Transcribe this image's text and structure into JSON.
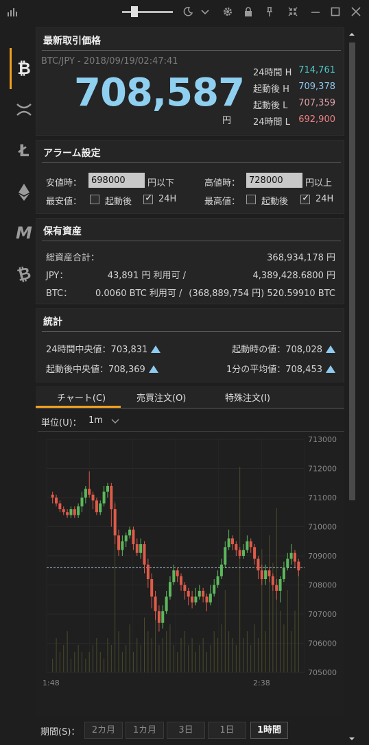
{
  "titlebar": {
    "icons": [
      "chart-bars-icon",
      "moon-icon",
      "chevron-down-icon",
      "gear-icon",
      "lock-icon",
      "pin-icon",
      "collapse-icon",
      "minimize-icon",
      "maximize-icon",
      "close-icon"
    ]
  },
  "sidebar": {
    "items": [
      {
        "name": "bitcoin",
        "glyph": "₿",
        "active": true
      },
      {
        "name": "ripple",
        "glyph": "✕"
      },
      {
        "name": "litecoin",
        "glyph": "Ł"
      },
      {
        "name": "ethereum",
        "glyph": "◆"
      },
      {
        "name": "monacoin",
        "glyph": "M"
      },
      {
        "name": "bitcoin-cash",
        "glyph": "₿"
      }
    ]
  },
  "latest": {
    "title": "最新取引価格",
    "pair_time": "BTC/JPY - 2018/09/19/02:47:41",
    "price": "708,587",
    "unit": "円",
    "stats": [
      {
        "label": "24時間 H",
        "value": "714,761",
        "color": "#4fc8c8"
      },
      {
        "label": "起動後 H",
        "value": "709,378",
        "color": "#8ec9f0"
      },
      {
        "label": "起動後 L",
        "value": "707,359",
        "color": "#e0a0a8"
      },
      {
        "label": "24時間 L",
        "value": "692,900",
        "color": "#f08080"
      }
    ],
    "price_color": "#8fd0f0"
  },
  "alarm": {
    "title": "アラーム設定",
    "low_label": "安値時：",
    "low_value": "698000",
    "low_suffix": "円以下",
    "high_label": "高値時：",
    "high_value": "728000",
    "high_suffix": "円以上",
    "min_label": "最安値：",
    "max_label": "最高値：",
    "since_start": "起動後",
    "h24": "24H",
    "min_since_start_checked": false,
    "min_h24_checked": true,
    "max_since_start_checked": false,
    "max_h24_checked": true
  },
  "assets": {
    "title": "保有資産",
    "total_label": "総資産合計：",
    "total_value": "368,934,178 円",
    "jpy_label": "JPY：",
    "jpy_value": "43,891 円 利用可 /",
    "jpy_total": "4,389,428.6800 円",
    "btc_label": "BTC：",
    "btc_value": "0.0060 BTC 利用可 /",
    "btc_total": "(368,889,754 円) 520.59910 BTC"
  },
  "stats": {
    "title": "統計",
    "median24_label": "24時間中央値：",
    "median24_value": "703,831",
    "start_value_label": "起動時の値：",
    "start_value": "708,028",
    "median_since_label": "起動後中央値：",
    "median_since_value": "708,369",
    "avg1m_label": "1分の平均値：",
    "avg1m_value": "708,453"
  },
  "tabs": [
    {
      "label": "チャート(C)",
      "active": true
    },
    {
      "label": "売買注文(O)"
    },
    {
      "label": "特殊注文(I)"
    }
  ],
  "chart_controls": {
    "unit_label": "単位(U)：",
    "unit_value": "1m"
  },
  "chart_data": {
    "type": "candlestick",
    "y_ticks": [
      "713000",
      "712000",
      "711000",
      "710000",
      "709000",
      "708000",
      "707000",
      "706000",
      "705000"
    ],
    "ylim": [
      705000,
      713000
    ],
    "x_ticks": [
      "1:48",
      "2:38"
    ],
    "reference_line": 708587,
    "up_color": "#5cb85c",
    "down_color": "#e05a4a",
    "candles": [
      [
        711100,
        711000,
        711200,
        710800
      ],
      [
        711000,
        710800,
        711100,
        710700
      ],
      [
        710800,
        710600,
        710900,
        710500
      ],
      [
        710600,
        710500,
        710700,
        710400
      ],
      [
        710500,
        710400,
        710600,
        710300
      ],
      [
        710400,
        710600,
        710700,
        710300
      ],
      [
        710600,
        710400,
        710700,
        710300
      ],
      [
        710400,
        710700,
        710800,
        710300
      ],
      [
        710700,
        711000,
        711200,
        710500
      ],
      [
        711000,
        711300,
        711400,
        710800
      ],
      [
        711300,
        711100,
        711900,
        711000
      ],
      [
        711100,
        710900,
        711200,
        710600
      ],
      [
        710900,
        710500,
        711000,
        710400
      ],
      [
        710500,
        710800,
        710900,
        710400
      ],
      [
        710800,
        711200,
        711400,
        710700
      ],
      [
        711200,
        711400,
        711500,
        711000
      ],
      [
        711400,
        710600,
        711500,
        710000
      ],
      [
        710600,
        709700,
        710800,
        709400
      ],
      [
        709700,
        709200,
        709900,
        709000
      ],
      [
        709200,
        709500,
        709700,
        709000
      ],
      [
        709500,
        709700,
        709800,
        709300
      ],
      [
        709700,
        709900,
        710000,
        709600
      ],
      [
        709900,
        709400,
        710000,
        709200
      ],
      [
        709400,
        709100,
        709600,
        709000
      ],
      [
        709100,
        709400,
        709600,
        708900
      ],
      [
        709400,
        708700,
        709500,
        708400
      ],
      [
        708700,
        708200,
        708900,
        707900
      ],
      [
        708200,
        707600,
        708400,
        707200
      ],
      [
        707600,
        707100,
        707800,
        706800
      ],
      [
        707100,
        706700,
        707300,
        706400
      ],
      [
        706700,
        707100,
        707300,
        706500
      ],
      [
        707100,
        707600,
        707800,
        707000
      ],
      [
        707600,
        708100,
        708300,
        707500
      ],
      [
        708100,
        708500,
        708700,
        708000
      ],
      [
        708500,
        708300,
        708600,
        708100
      ],
      [
        708300,
        708000,
        708400,
        707800
      ],
      [
        708000,
        707800,
        708100,
        707500
      ],
      [
        707800,
        707600,
        707900,
        707300
      ],
      [
        707600,
        707400,
        707800,
        707200
      ],
      [
        707400,
        707600,
        707900,
        707300
      ],
      [
        707600,
        707800,
        708000,
        707500
      ],
      [
        707800,
        707600,
        707900,
        707400
      ],
      [
        707600,
        707400,
        707700,
        707100
      ],
      [
        707400,
        707700,
        708000,
        707300
      ],
      [
        707700,
        708000,
        708200,
        707600
      ],
      [
        708000,
        708300,
        708500,
        707900
      ],
      [
        708300,
        708700,
        708900,
        708200
      ],
      [
        708700,
        709300,
        709500,
        708600
      ],
      [
        709300,
        709600,
        709900,
        709200
      ],
      [
        709600,
        709400,
        709700,
        709200
      ],
      [
        709400,
        709200,
        709500,
        709000
      ],
      [
        709200,
        709000,
        709300,
        708900
      ],
      [
        709000,
        709200,
        709400,
        708900
      ],
      [
        709200,
        709500,
        709700,
        709100
      ],
      [
        709500,
        709300,
        709600,
        709100
      ],
      [
        709300,
        708900,
        709400,
        708700
      ],
      [
        708900,
        708500,
        709000,
        708200
      ],
      [
        708500,
        708200,
        708700,
        708000
      ],
      [
        708200,
        708500,
        708700,
        708000
      ],
      [
        708500,
        708300,
        708600,
        708100
      ],
      [
        708300,
        708000,
        708400,
        707800
      ],
      [
        708000,
        707800,
        708200,
        707500
      ],
      [
        707800,
        708200,
        708300,
        707400
      ],
      [
        708200,
        708600,
        708800,
        708100
      ],
      [
        708600,
        708900,
        709100,
        708500
      ],
      [
        708900,
        709100,
        709400,
        708700
      ],
      [
        709100,
        708800,
        709200,
        708600
      ],
      [
        708800,
        708500,
        708900,
        708300
      ]
    ],
    "volumes": [
      2,
      5,
      3,
      4,
      6,
      2,
      3,
      4,
      3,
      2,
      3,
      4,
      5,
      3,
      2,
      5,
      4,
      25,
      6,
      3,
      4,
      7,
      3,
      5,
      4,
      8,
      6,
      5,
      9,
      4,
      5,
      6,
      7,
      4,
      3,
      5,
      6,
      4,
      5,
      3,
      4,
      5,
      3,
      4,
      6,
      5,
      7,
      12,
      6,
      5,
      4,
      30,
      5,
      6,
      4,
      7,
      5,
      18,
      6,
      20,
      16,
      24,
      9,
      7,
      12,
      6,
      9,
      16
    ]
  },
  "period": {
    "label": "期間(S)：",
    "options": [
      {
        "label": "2カ月"
      },
      {
        "label": "1カ月"
      },
      {
        "label": "3日"
      },
      {
        "label": "1日"
      },
      {
        "label": "1時間",
        "selected": true
      }
    ]
  }
}
